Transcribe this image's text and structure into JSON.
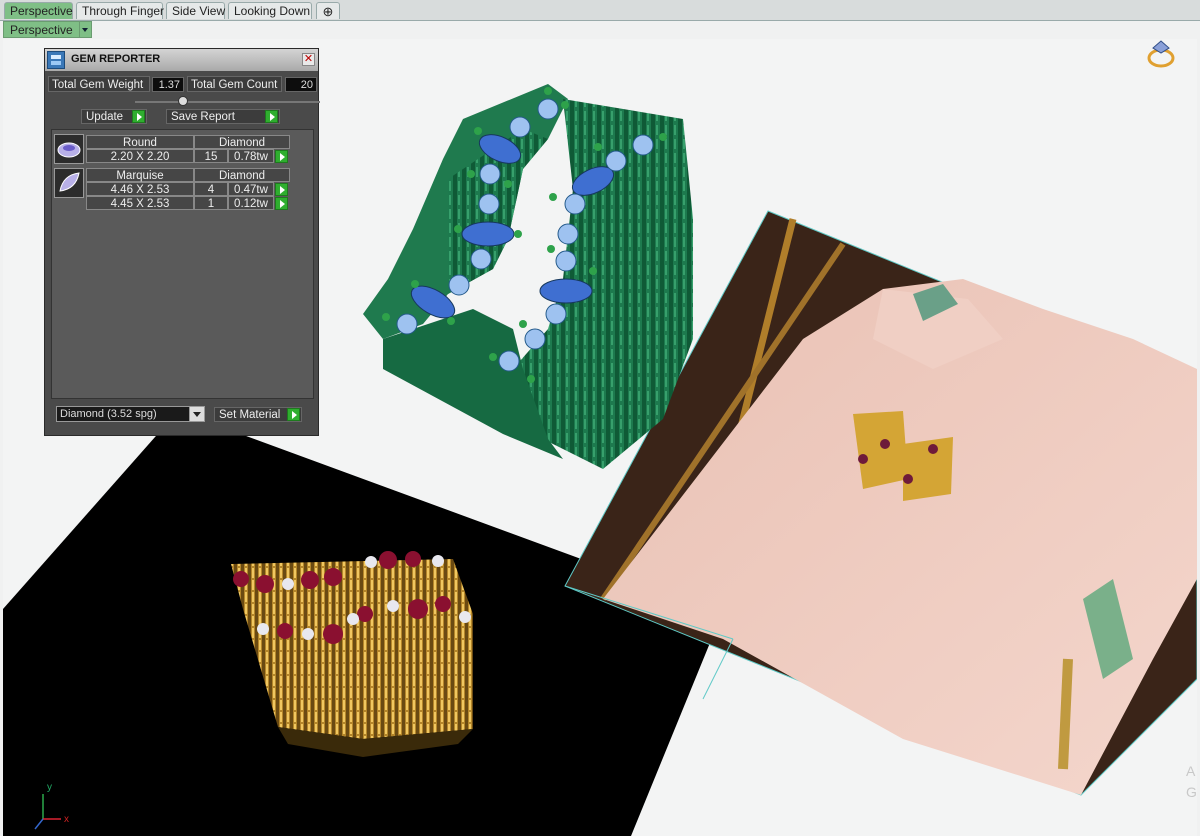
{
  "tabs": [
    {
      "label": "Perspective",
      "active": true
    },
    {
      "label": "Through Finger",
      "active": false
    },
    {
      "label": "Side View",
      "active": false
    },
    {
      "label": "Looking Down",
      "active": false
    }
  ],
  "tab_add_icon": "plus-icon",
  "view_dropdown": {
    "value": "Perspective"
  },
  "gem_reporter": {
    "title": "GEM REPORTER",
    "total_weight_label": "Total Gem Weight",
    "total_weight_value": "1.37",
    "total_count_label": "Total Gem Count",
    "total_count_value": "20",
    "update_label": "Update",
    "save_report_label": "Save Report",
    "groups": [
      {
        "shape": "Round",
        "material": "Diamond",
        "rows": [
          {
            "size": "2.20 X 2.20",
            "count": "15",
            "weight": "0.78tw"
          }
        ]
      },
      {
        "shape": "Marquise",
        "material": "Diamond",
        "rows": [
          {
            "size": "4.46 X 2.53",
            "count": "4",
            "weight": "0.47tw"
          },
          {
            "size": "4.45 X 2.53",
            "count": "1",
            "weight": "0.12tw"
          }
        ]
      }
    ],
    "material_select": "Diamond    (3.52 spg)",
    "set_material_label": "Set Material"
  },
  "axis": {
    "y": "y",
    "x": "x"
  },
  "watermark": {
    "line1": "A",
    "line2": "G"
  },
  "colors": {
    "tab_active": "#7fbf86",
    "model_green": "#1f7a4e",
    "gem_blue": "#3f6fd1",
    "gem_light": "#9ec2f0",
    "gold": "#c79a2e",
    "ruby": "#8a1030",
    "photo_outline": "#5fc9c6"
  }
}
